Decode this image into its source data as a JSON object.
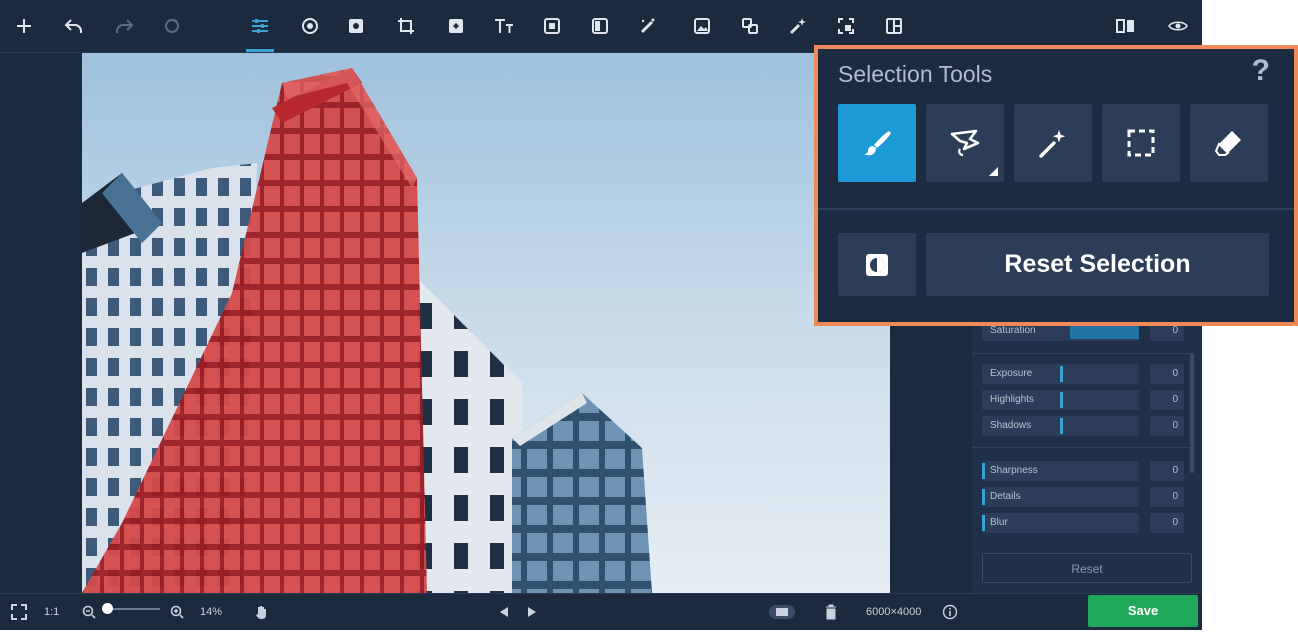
{
  "toolbar": {
    "icons": [
      "add-icon",
      "undo-icon",
      "redo-icon",
      "rotate-icon",
      "adjust-icon",
      "filters-icon",
      "enhance-icon",
      "crop-icon",
      "mask-icon",
      "text-icon",
      "frame-icon",
      "gradient-icon",
      "retouch-icon",
      "image-icon",
      "clone-icon",
      "magic-wand-icon",
      "selection-icon",
      "split-icon"
    ],
    "active": "adjust-icon"
  },
  "adjust_panel": {
    "group1": [
      {
        "label": "Saturation",
        "value": "0"
      }
    ],
    "group2": [
      {
        "label": "Exposure",
        "value": "0"
      },
      {
        "label": "Highlights",
        "value": "0"
      },
      {
        "label": "Shadows",
        "value": "0"
      }
    ],
    "group3": [
      {
        "label": "Sharpness",
        "value": "0"
      },
      {
        "label": "Details",
        "value": "0"
      },
      {
        "label": "Blur",
        "value": "0"
      }
    ],
    "reset_label": "Reset"
  },
  "bottom": {
    "one_to_one": "1:1",
    "zoom_percent": "14%",
    "image_size": "6000×4000",
    "save_label": "Save"
  },
  "selection_tools": {
    "title": "Selection Tools",
    "help": "?",
    "tools": [
      "brush-icon",
      "lasso-icon",
      "magic-wand-icon",
      "rectangle-selection-icon",
      "eraser-icon"
    ],
    "active_tool": "brush-icon",
    "reset_label": "Reset Selection"
  },
  "colors": {
    "accent": "#1b9ad6",
    "save": "#1fa85a",
    "highlight_border": "#f0895a",
    "selection_mask": "#d23a3a"
  }
}
